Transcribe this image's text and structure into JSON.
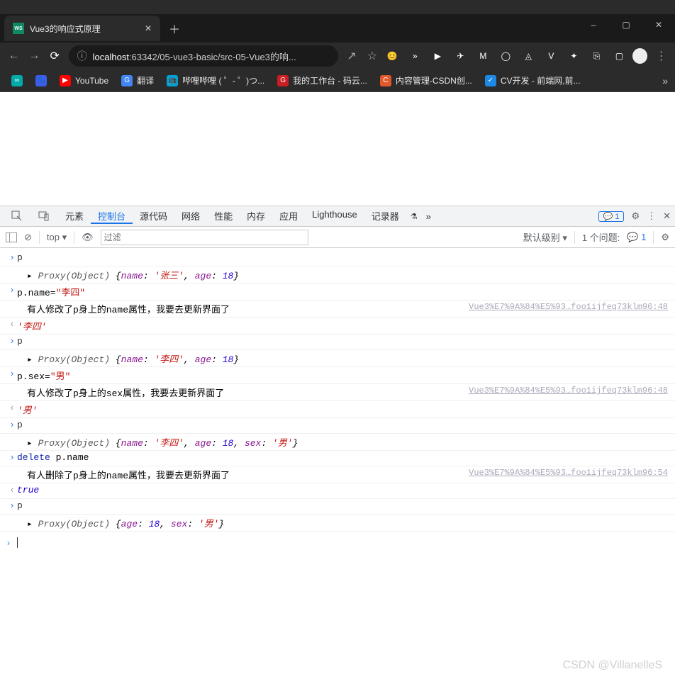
{
  "window": {
    "min": "–",
    "max": "▢",
    "close": "✕"
  },
  "tab": {
    "icon": "WS",
    "title": "Vue3的响应式原理"
  },
  "address": {
    "host": "localhost",
    "path": ":63342/05-vue3-basic/src-05-Vue3的响...",
    "share": "↗",
    "star": "☆"
  },
  "ext_icons": [
    "😊",
    "»",
    "▶",
    "✈",
    "M",
    "◯",
    "◬",
    "V",
    "✦",
    "⎘",
    "▢"
  ],
  "bookmarks": [
    {
      "icon": "∞",
      "c": "#0aa",
      "text": ""
    },
    {
      "icon": "🐾",
      "c": "#3b5de7",
      "text": ""
    },
    {
      "icon": "▶",
      "c": "#f00",
      "text": "YouTube"
    },
    {
      "icon": "G",
      "c": "#4285f4",
      "text": "翻译"
    },
    {
      "icon": "📺",
      "c": "#00a1d6",
      "text": "哔哩哔哩 ( ゜- ゜)つ..."
    },
    {
      "icon": "G",
      "c": "#c71d23",
      "text": "我的工作台 - 码云..."
    },
    {
      "icon": "C",
      "c": "#e1592b",
      "text": "内容管理-CSDN创..."
    },
    {
      "icon": "✓",
      "c": "#1e88e5",
      "text": "CV开发 - 前端网,前..."
    }
  ],
  "devtools": {
    "tabs": [
      "元素",
      "控制台",
      "源代码",
      "网络",
      "性能",
      "内存",
      "应用",
      "Lighthouse",
      "记录器"
    ],
    "experimental": "⚗",
    "more": "»",
    "issue_badge": "💬 1",
    "gear": "⚙",
    "dots": "⋮",
    "close": "✕"
  },
  "console_bar": {
    "play": "▶",
    "clear": "⊘",
    "context": "top ▾",
    "eye": "👁",
    "filter_placeholder": "过滤",
    "levels": "默认级别 ▾",
    "issues_label": "1 个问题:",
    "issue_icon": "💬 1",
    "gear": "⚙"
  },
  "logs": [
    {
      "t": "in",
      "text": "p"
    },
    {
      "t": "out_obj",
      "parts": [
        "▸ ",
        {
          "type": "type",
          "v": "Proxy(Object) "
        },
        "{",
        {
          "type": "key",
          "v": "name"
        },
        ": ",
        {
          "type": "str",
          "v": "'张三'"
        },
        ", ",
        {
          "type": "key",
          "v": "age"
        },
        ": ",
        {
          "type": "num",
          "v": "18"
        },
        "}"
      ]
    },
    {
      "t": "in_assign",
      "parts": [
        "p.name=",
        {
          "type": "str",
          "v": "\"李四\""
        }
      ]
    },
    {
      "t": "log",
      "msg": "有人修改了p身上的name属性，我要去更新界面了",
      "src": "Vue3%E7%9A%84%E5%93…foo1ijfeq73klm96:48"
    },
    {
      "t": "ret",
      "parts": [
        {
          "type": "str",
          "v": "'李四'"
        }
      ]
    },
    {
      "t": "in",
      "text": "p"
    },
    {
      "t": "out_obj",
      "parts": [
        "▸ ",
        {
          "type": "type",
          "v": "Proxy(Object) "
        },
        "{",
        {
          "type": "key",
          "v": "name"
        },
        ": ",
        {
          "type": "str",
          "v": "'李四'"
        },
        ", ",
        {
          "type": "key",
          "v": "age"
        },
        ": ",
        {
          "type": "num",
          "v": "18"
        },
        "}"
      ]
    },
    {
      "t": "in_assign",
      "parts": [
        "p.sex=",
        {
          "type": "str",
          "v": "\"男\""
        }
      ]
    },
    {
      "t": "log",
      "msg": "有人修改了p身上的sex属性，我要去更新界面了",
      "src": "Vue3%E7%9A%84%E5%93…foo1ijfeq73klm96:48"
    },
    {
      "t": "ret",
      "parts": [
        {
          "type": "str",
          "v": "'男'"
        }
      ]
    },
    {
      "t": "in",
      "text": "p"
    },
    {
      "t": "out_obj",
      "parts": [
        "▸ ",
        {
          "type": "type",
          "v": "Proxy(Object) "
        },
        "{",
        {
          "type": "key",
          "v": "name"
        },
        ": ",
        {
          "type": "str",
          "v": "'李四'"
        },
        ", ",
        {
          "type": "key",
          "v": "age"
        },
        ": ",
        {
          "type": "num",
          "v": "18"
        },
        ", ",
        {
          "type": "key",
          "v": "sex"
        },
        ": ",
        {
          "type": "str",
          "v": "'男'"
        },
        "}"
      ]
    },
    {
      "t": "in_del",
      "parts": [
        {
          "type": "del",
          "v": "delete"
        },
        " p.name"
      ]
    },
    {
      "t": "log",
      "msg": "有人删除了p身上的name属性，我要去更新界面了",
      "src": "Vue3%E7%9A%84%E5%93…foo1ijfeq73klm96:54"
    },
    {
      "t": "ret",
      "parts": [
        {
          "type": "bool",
          "v": "true"
        }
      ]
    },
    {
      "t": "in",
      "text": "p"
    },
    {
      "t": "out_obj",
      "parts": [
        "▸ ",
        {
          "type": "type",
          "v": "Proxy(Object) "
        },
        "{",
        {
          "type": "key",
          "v": "age"
        },
        ": ",
        {
          "type": "num",
          "v": "18"
        },
        ", ",
        {
          "type": "key",
          "v": "sex"
        },
        ": ",
        {
          "type": "str",
          "v": "'男'"
        },
        "}"
      ]
    }
  ],
  "watermark": "CSDN @VillanelleS"
}
